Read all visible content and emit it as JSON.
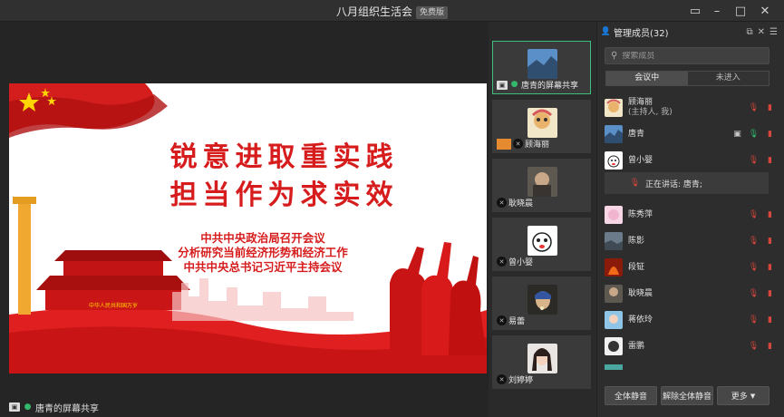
{
  "window": {
    "title": "八月组织生活会",
    "badge": "免费版",
    "min_icon": "minimize-icon",
    "max_icon": "maximize-icon",
    "close_icon": "close-icon"
  },
  "slide": {
    "headline1": "锐意进取重实践",
    "headline2": "担当作为求实效",
    "line1": "中共中央政治局召开会议",
    "line2": "分析研究当前经济形势和经济工作",
    "line3": "中共中央总书记习近平主持会议",
    "gate_banner": "中华人民共和国万岁"
  },
  "share_status": {
    "label": "唐青的屏幕共享"
  },
  "video_tiles": [
    {
      "name": "唐青的屏幕共享",
      "active": true
    },
    {
      "name": "顾海丽"
    },
    {
      "name": "耿晓晨"
    },
    {
      "name": "曾小婴"
    },
    {
      "name": "易蕾"
    },
    {
      "name": "刘婷婷"
    }
  ],
  "panel": {
    "title": "管理成员(32)",
    "search_placeholder": "搜索成员",
    "tab_in": "会议中",
    "tab_out": "未进入",
    "speaking_label": "正在讲话: 唐青;",
    "members": [
      {
        "name": "顾海丽",
        "sub": "(主持人, 我)",
        "mic": "off",
        "cam": "off"
      },
      {
        "name": "唐青",
        "mic": "on",
        "cam": "off",
        "screen": true
      },
      {
        "name": "曾小婴",
        "mic": "off",
        "cam": "off"
      },
      {
        "name": "陈秀萍",
        "mic": "off",
        "cam": "off"
      },
      {
        "name": "陈影",
        "mic": "off",
        "cam": "off"
      },
      {
        "name": "段钲",
        "mic": "off",
        "cam": "off"
      },
      {
        "name": "耿晓晨",
        "mic": "off",
        "cam": "off"
      },
      {
        "name": "蒋依玲",
        "mic": "off",
        "cam": "off"
      },
      {
        "name": "雷鹏",
        "mic": "off",
        "cam": "off"
      }
    ],
    "btn_mute_all": "全体静音",
    "btn_unmute_all": "解除全体静音",
    "btn_more": "更多"
  }
}
